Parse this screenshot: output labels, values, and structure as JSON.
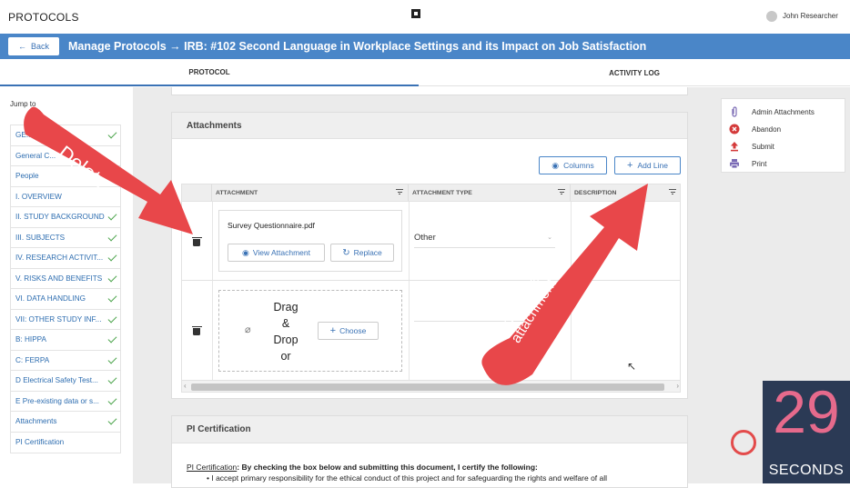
{
  "app": {
    "title": "PROTOCOLS",
    "user_name": "John Researcher"
  },
  "header": {
    "back_label": "Back",
    "page_title": "Manage Protocols → IRB: #102 Second Language in Workplace Settings and its Impact on Job Satisfaction"
  },
  "tabs": [
    {
      "label": "PROTOCOL",
      "active": true
    },
    {
      "label": "ACTIVITY LOG",
      "active": false
    }
  ],
  "sidebar": {
    "jump_label": "Jump to",
    "items": [
      {
        "label": "GE...",
        "checked": true
      },
      {
        "label": "General C...",
        "checked": false
      },
      {
        "label": "People",
        "checked": false
      },
      {
        "label": "I. OVERVIEW",
        "checked": false
      },
      {
        "label": "II. STUDY BACKGROUND",
        "checked": true
      },
      {
        "label": "III. SUBJECTS",
        "checked": true
      },
      {
        "label": "IV. RESEARCH ACTIVIT...",
        "checked": true
      },
      {
        "label": "V. RISKS AND BENEFITS",
        "checked": true
      },
      {
        "label": "VI. DATA HANDLING",
        "checked": true
      },
      {
        "label": "VII: OTHER STUDY INF...",
        "checked": true
      },
      {
        "label": "B: HIPPA",
        "checked": true
      },
      {
        "label": "C: FERPA",
        "checked": true
      },
      {
        "label": "D Electrical Safety Test...",
        "checked": true
      },
      {
        "label": "E Pre-existing data or s...",
        "checked": true
      },
      {
        "label": "Attachments",
        "checked": true
      },
      {
        "label": "PI Certification",
        "checked": false
      }
    ]
  },
  "attachments": {
    "title": "Attachments",
    "columns_label": "Columns",
    "add_line_label": "Add Line",
    "headers": [
      "ATTACHMENT",
      "ATTACHMENT TYPE",
      "DESCRIPTION"
    ],
    "row1": {
      "file_name": "Survey Questionnaire.pdf",
      "view_label": "View Attachment",
      "replace_label": "Replace",
      "type": "Other"
    },
    "row2": {
      "drop_text": "Drag\n&\nDrop\nor",
      "choose_label": "Choose"
    }
  },
  "certification": {
    "title": "PI Certification",
    "link": "PI Certification",
    "intro": ": By checking the box below and submitting this document, I certify the following:",
    "bullet": "I accept primary responsibility for the ethical conduct of this project and for safeguarding the rights and welfare of all"
  },
  "actions": [
    {
      "label": "Admin Attachments",
      "icon": "paperclip-icon",
      "color": "#7b6bb5"
    },
    {
      "label": "Abandon",
      "icon": "close-circle-icon",
      "color": "#d43a3a"
    },
    {
      "label": "Submit",
      "icon": "upload-icon",
      "color": "#d43a3a"
    },
    {
      "label": "Print",
      "icon": "printer-icon",
      "color": "#7b6bb5"
    }
  ],
  "annotations": {
    "delete_label": "Delete",
    "add_label": "Add anther\nattachment"
  },
  "timer": {
    "value": "29",
    "label": "SECONDS"
  },
  "colors": {
    "brand_blue": "#4a86c8",
    "arrow_red": "#e8474a",
    "check_green": "#4aa34a",
    "timer_bg": "#2b3a55",
    "timer_pink": "#e66a8c"
  }
}
